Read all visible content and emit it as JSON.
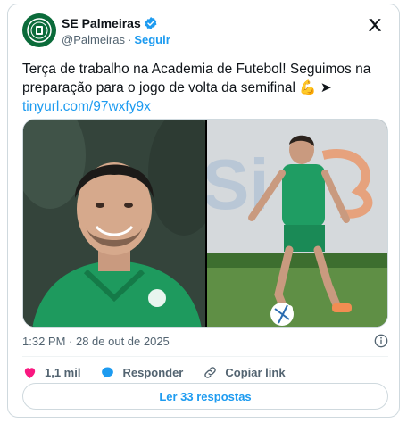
{
  "header": {
    "name": "SE Palmeiras",
    "handle": "@Palmeiras",
    "separator": "·",
    "follow_label": "Seguir"
  },
  "tweet": {
    "text": "Terça de trabalho na Academia de Futebol! Seguimos na preparação para o jogo de volta da semifinal",
    "emoji": "💪 ➤",
    "link": "tinyurl.com/97wxfy9x"
  },
  "meta": {
    "timestamp": "1:32 PM · 28 de out de 2025"
  },
  "actions": {
    "likes": "1,1 mil",
    "reply_label": "Responder",
    "copy_label": "Copiar link"
  },
  "replies_button": "Ler 33 respostas",
  "colors": {
    "accent": "#1d9bf0",
    "heart": "#f91880",
    "palmeiras_green": "#0b6b3a",
    "jersey_green": "#1f9d63"
  }
}
